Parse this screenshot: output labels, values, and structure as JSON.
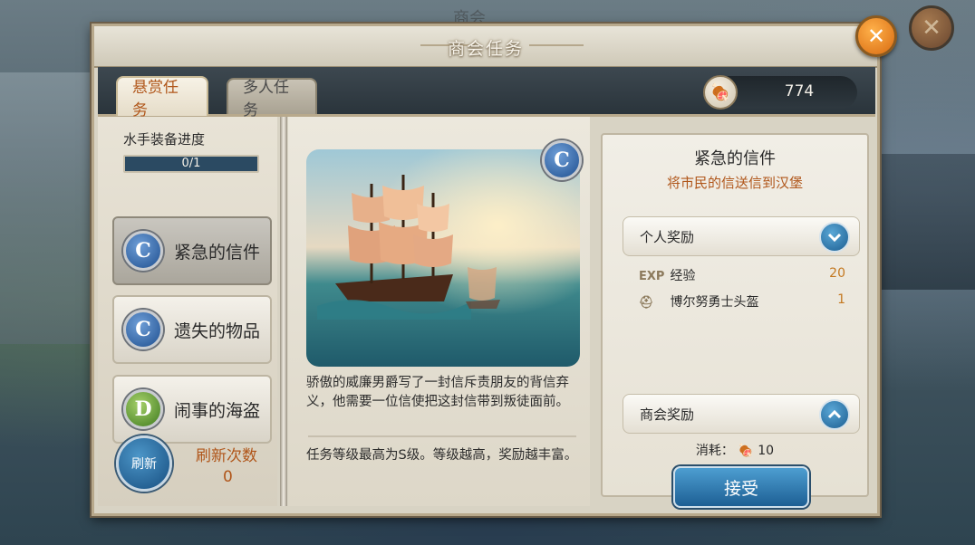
{
  "background": {
    "title": "商会"
  },
  "dialog": {
    "title": "商会任务"
  },
  "tabs": {
    "active": "悬赏任务",
    "inactive": "多人任务"
  },
  "currency": {
    "value": "774",
    "icon": "meat-icon"
  },
  "progress": {
    "label": "水手装备进度",
    "text": "0/1",
    "fraction": 0.0
  },
  "tasks": [
    {
      "grade": "C",
      "label": "紧急的信件",
      "selected": true
    },
    {
      "grade": "C",
      "label": "遗失的物品",
      "selected": false
    },
    {
      "grade": "D",
      "label": "闹事的海盗",
      "selected": false
    }
  ],
  "refresh": {
    "button": "刷新",
    "count_label": "刷新次数",
    "count": "0"
  },
  "detail": {
    "grade": "C",
    "description": "骄傲的威廉男爵写了一封信斥责朋友的背信弃义，他需要一位信使把这封信带到叛徒面前。",
    "hint": "任务等级最高为S级。等级越高，奖励越丰富。"
  },
  "task_panel": {
    "title": "紧急的信件",
    "subtitle": "将市民的信送信到汉堡",
    "personal_reward": {
      "label": "个人奖励",
      "items": [
        {
          "icon": "EXP",
          "name": "经验",
          "value": "20"
        },
        {
          "icon": "helmet-icon",
          "name": "博尔努勇士头盔",
          "value": "1"
        }
      ]
    },
    "guild_reward": {
      "label": "商会奖励"
    },
    "cost": {
      "label": "消耗：",
      "value": "10"
    },
    "accept": "接受"
  },
  "colors": {
    "accent_orange": "#b0561a",
    "button_blue": "#1d5f94",
    "close_orange": "#d86a10"
  }
}
